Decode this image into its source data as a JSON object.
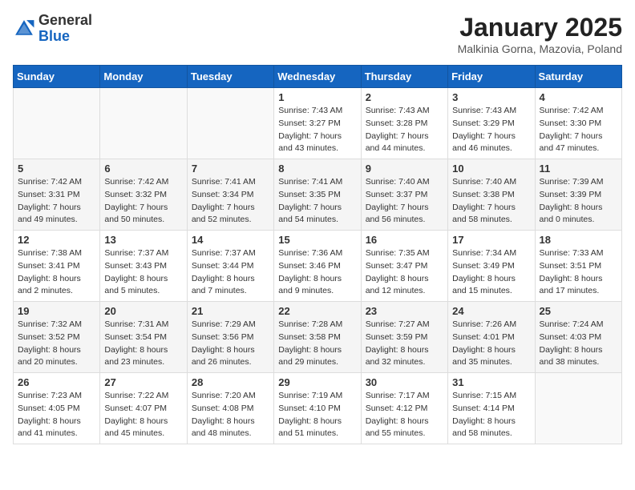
{
  "header": {
    "logo_general": "General",
    "logo_blue": "Blue",
    "month_title": "January 2025",
    "location": "Malkinia Gorna, Mazovia, Poland"
  },
  "weekdays": [
    "Sunday",
    "Monday",
    "Tuesday",
    "Wednesday",
    "Thursday",
    "Friday",
    "Saturday"
  ],
  "weeks": [
    [
      {
        "day": "",
        "info": ""
      },
      {
        "day": "",
        "info": ""
      },
      {
        "day": "",
        "info": ""
      },
      {
        "day": "1",
        "info": "Sunrise: 7:43 AM\nSunset: 3:27 PM\nDaylight: 7 hours\nand 43 minutes."
      },
      {
        "day": "2",
        "info": "Sunrise: 7:43 AM\nSunset: 3:28 PM\nDaylight: 7 hours\nand 44 minutes."
      },
      {
        "day": "3",
        "info": "Sunrise: 7:43 AM\nSunset: 3:29 PM\nDaylight: 7 hours\nand 46 minutes."
      },
      {
        "day": "4",
        "info": "Sunrise: 7:42 AM\nSunset: 3:30 PM\nDaylight: 7 hours\nand 47 minutes."
      }
    ],
    [
      {
        "day": "5",
        "info": "Sunrise: 7:42 AM\nSunset: 3:31 PM\nDaylight: 7 hours\nand 49 minutes."
      },
      {
        "day": "6",
        "info": "Sunrise: 7:42 AM\nSunset: 3:32 PM\nDaylight: 7 hours\nand 50 minutes."
      },
      {
        "day": "7",
        "info": "Sunrise: 7:41 AM\nSunset: 3:34 PM\nDaylight: 7 hours\nand 52 minutes."
      },
      {
        "day": "8",
        "info": "Sunrise: 7:41 AM\nSunset: 3:35 PM\nDaylight: 7 hours\nand 54 minutes."
      },
      {
        "day": "9",
        "info": "Sunrise: 7:40 AM\nSunset: 3:37 PM\nDaylight: 7 hours\nand 56 minutes."
      },
      {
        "day": "10",
        "info": "Sunrise: 7:40 AM\nSunset: 3:38 PM\nDaylight: 7 hours\nand 58 minutes."
      },
      {
        "day": "11",
        "info": "Sunrise: 7:39 AM\nSunset: 3:39 PM\nDaylight: 8 hours\nand 0 minutes."
      }
    ],
    [
      {
        "day": "12",
        "info": "Sunrise: 7:38 AM\nSunset: 3:41 PM\nDaylight: 8 hours\nand 2 minutes."
      },
      {
        "day": "13",
        "info": "Sunrise: 7:37 AM\nSunset: 3:43 PM\nDaylight: 8 hours\nand 5 minutes."
      },
      {
        "day": "14",
        "info": "Sunrise: 7:37 AM\nSunset: 3:44 PM\nDaylight: 8 hours\nand 7 minutes."
      },
      {
        "day": "15",
        "info": "Sunrise: 7:36 AM\nSunset: 3:46 PM\nDaylight: 8 hours\nand 9 minutes."
      },
      {
        "day": "16",
        "info": "Sunrise: 7:35 AM\nSunset: 3:47 PM\nDaylight: 8 hours\nand 12 minutes."
      },
      {
        "day": "17",
        "info": "Sunrise: 7:34 AM\nSunset: 3:49 PM\nDaylight: 8 hours\nand 15 minutes."
      },
      {
        "day": "18",
        "info": "Sunrise: 7:33 AM\nSunset: 3:51 PM\nDaylight: 8 hours\nand 17 minutes."
      }
    ],
    [
      {
        "day": "19",
        "info": "Sunrise: 7:32 AM\nSunset: 3:52 PM\nDaylight: 8 hours\nand 20 minutes."
      },
      {
        "day": "20",
        "info": "Sunrise: 7:31 AM\nSunset: 3:54 PM\nDaylight: 8 hours\nand 23 minutes."
      },
      {
        "day": "21",
        "info": "Sunrise: 7:29 AM\nSunset: 3:56 PM\nDaylight: 8 hours\nand 26 minutes."
      },
      {
        "day": "22",
        "info": "Sunrise: 7:28 AM\nSunset: 3:58 PM\nDaylight: 8 hours\nand 29 minutes."
      },
      {
        "day": "23",
        "info": "Sunrise: 7:27 AM\nSunset: 3:59 PM\nDaylight: 8 hours\nand 32 minutes."
      },
      {
        "day": "24",
        "info": "Sunrise: 7:26 AM\nSunset: 4:01 PM\nDaylight: 8 hours\nand 35 minutes."
      },
      {
        "day": "25",
        "info": "Sunrise: 7:24 AM\nSunset: 4:03 PM\nDaylight: 8 hours\nand 38 minutes."
      }
    ],
    [
      {
        "day": "26",
        "info": "Sunrise: 7:23 AM\nSunset: 4:05 PM\nDaylight: 8 hours\nand 41 minutes."
      },
      {
        "day": "27",
        "info": "Sunrise: 7:22 AM\nSunset: 4:07 PM\nDaylight: 8 hours\nand 45 minutes."
      },
      {
        "day": "28",
        "info": "Sunrise: 7:20 AM\nSunset: 4:08 PM\nDaylight: 8 hours\nand 48 minutes."
      },
      {
        "day": "29",
        "info": "Sunrise: 7:19 AM\nSunset: 4:10 PM\nDaylight: 8 hours\nand 51 minutes."
      },
      {
        "day": "30",
        "info": "Sunrise: 7:17 AM\nSunset: 4:12 PM\nDaylight: 8 hours\nand 55 minutes."
      },
      {
        "day": "31",
        "info": "Sunrise: 7:15 AM\nSunset: 4:14 PM\nDaylight: 8 hours\nand 58 minutes."
      },
      {
        "day": "",
        "info": ""
      }
    ]
  ]
}
